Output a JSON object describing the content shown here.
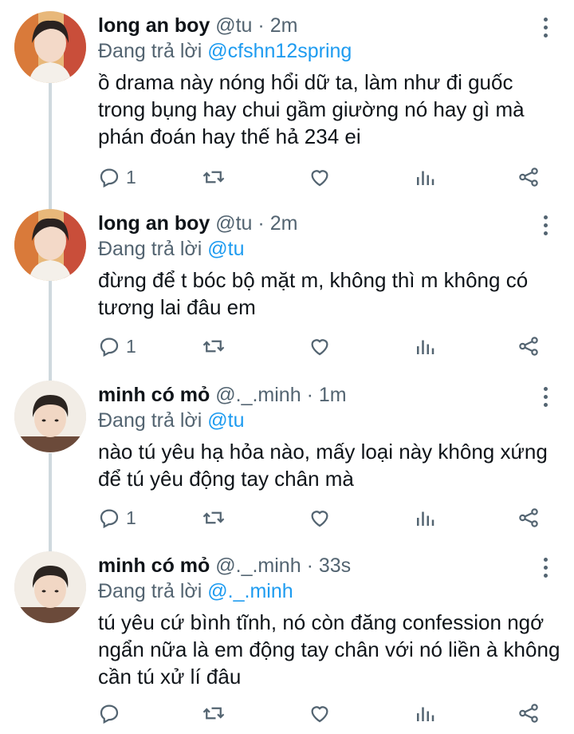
{
  "tweets": [
    {
      "name": "long an boy",
      "handle": "@tu",
      "dot": "·",
      "time": "2m",
      "reply_prefix": "Đang trả lời",
      "reply_to": "@cfshn12spring",
      "text": "ồ drama này nóng hổi dữ ta, làm như đi guốc trong bụng hay chui gầm giường nó hay gì mà phán đoán hay thế hả 234 ei",
      "reply_count": "1"
    },
    {
      "name": "long an boy",
      "handle": "@tu",
      "dot": "·",
      "time": "2m",
      "reply_prefix": "Đang trả lời",
      "reply_to": "@tu",
      "text": "đừng để t bóc bộ mặt m, không thì m không có tương lai đâu em",
      "reply_count": "1"
    },
    {
      "name": "minh có mỏ",
      "handle": "@._.minh",
      "dot": "·",
      "time": "1m",
      "reply_prefix": "Đang trả lời",
      "reply_to": "@tu",
      "text": "nào tú yêu hạ hỏa nào, mấy loại này không xứng để tú yêu động tay chân mà",
      "reply_count": "1"
    },
    {
      "name": "minh có mỏ",
      "handle": "@._.minh",
      "dot": "·",
      "time": "33s",
      "reply_prefix": "Đang trả lời",
      "reply_to": "@._.minh",
      "text": "tú yêu cứ bình tĩnh, nó còn đăng confession ngớ ngẩn nữa là em động tay chân với nó liền à không cần tú xử lí đâu",
      "reply_count": ""
    }
  ],
  "icons": {
    "reply": "reply-icon",
    "retweet": "retweet-icon",
    "like": "like-icon",
    "views": "views-icon",
    "share": "share-icon",
    "more": "more-icon"
  },
  "colors": {
    "text": "#0f1419",
    "secondary": "#536471",
    "mention": "#1d9bf0",
    "thread_line": "#cfd9de"
  }
}
